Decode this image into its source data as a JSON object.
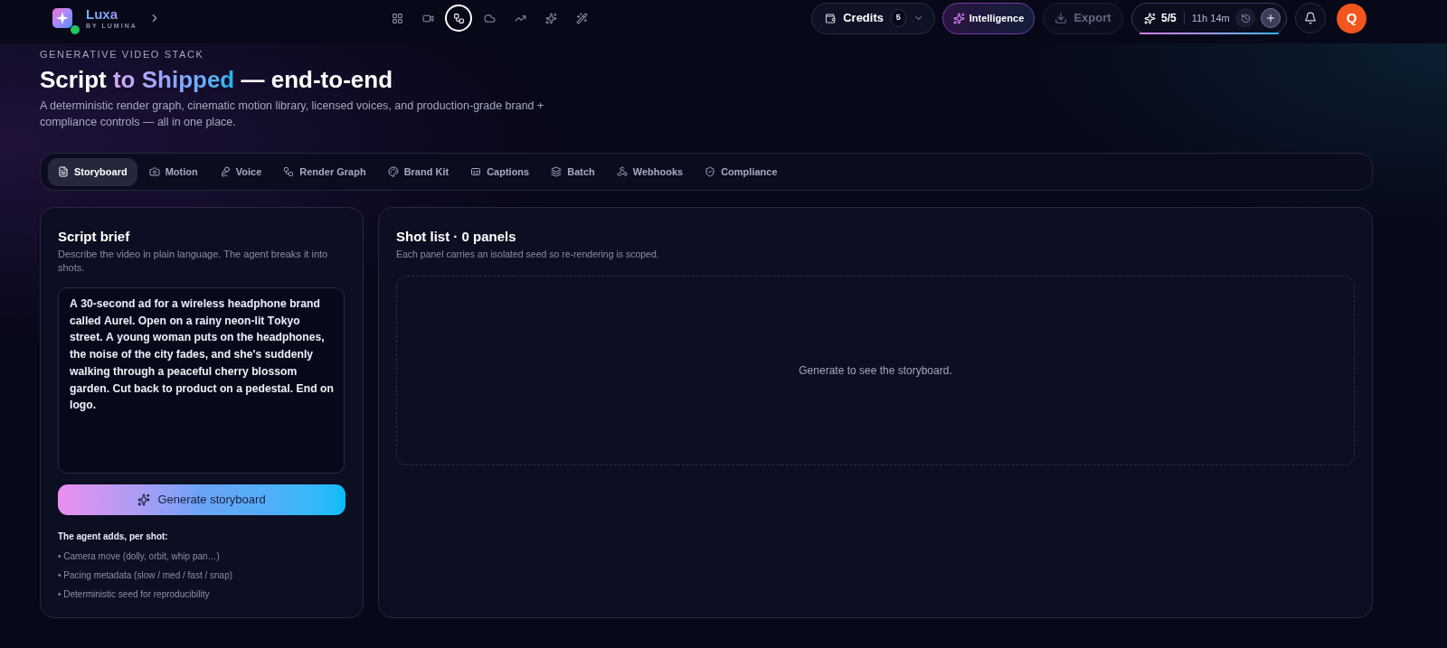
{
  "header": {
    "brand": {
      "name": "Luxa",
      "tagline": "BY LUMINA"
    },
    "toolbar": [
      {
        "selected": false
      },
      {
        "selected": false
      },
      {
        "selected": true
      },
      {
        "selected": false
      },
      {
        "selected": false
      },
      {
        "selected": false
      },
      {
        "selected": false
      }
    ],
    "credits": {
      "label": "Credits",
      "count": "5"
    },
    "intelligence": {
      "label": "Intelligence"
    },
    "export": {
      "label": "Export",
      "disabled": true
    },
    "quota": {
      "count": "5/5",
      "time": "11h 14m",
      "level": 1
    },
    "avatar": {
      "initial": "Q"
    }
  },
  "hero": {
    "eyebrow": "GENERATIVE VIDEO STACK",
    "title": {
      "lead": "Script",
      "highlight": "to Shipped",
      "tail": "— end-to-end"
    },
    "subtitle": "A deterministic render graph, cinematic motion library, licensed voices, and production-grade brand + compliance controls — all in one place."
  },
  "tabs": [
    {
      "label": "Storyboard",
      "selected": true
    },
    {
      "label": "Motion",
      "selected": false
    },
    {
      "label": "Voice",
      "selected": false
    },
    {
      "label": "Render Graph",
      "selected": false
    },
    {
      "label": "Brand Kit",
      "selected": false
    },
    {
      "label": "Captions",
      "selected": false
    },
    {
      "label": "Batch",
      "selected": false
    },
    {
      "label": "Webhooks",
      "selected": false
    },
    {
      "label": "Compliance",
      "selected": false
    }
  ],
  "script_brief": {
    "title": "Script brief",
    "description": "Describe the video in plain language. The agent breaks it into shots.",
    "value": "A 30-second ad for a wireless headphone brand called Aurel. Open on a rainy neon-lit Tokyo street. A young woman puts on the headphones, the noise of the city fades, and she's suddenly walking through a peaceful cherry blossom garden. Cut back to product on a pedestal. End on logo.",
    "button": "Generate storyboard",
    "notes_title": "The agent adds, per shot:",
    "notes": [
      "• Camera move (dolly, orbit, whip pan…)",
      "• Pacing metadata (slow / med / fast / snap)",
      "• Deterministic seed for reproducibility"
    ]
  },
  "shot_list": {
    "title": "Shot list · 0 panels",
    "description": "Each panel carries an isolated seed so re-rendering is scoped.",
    "empty_text": "Generate to see the storyboard."
  }
}
